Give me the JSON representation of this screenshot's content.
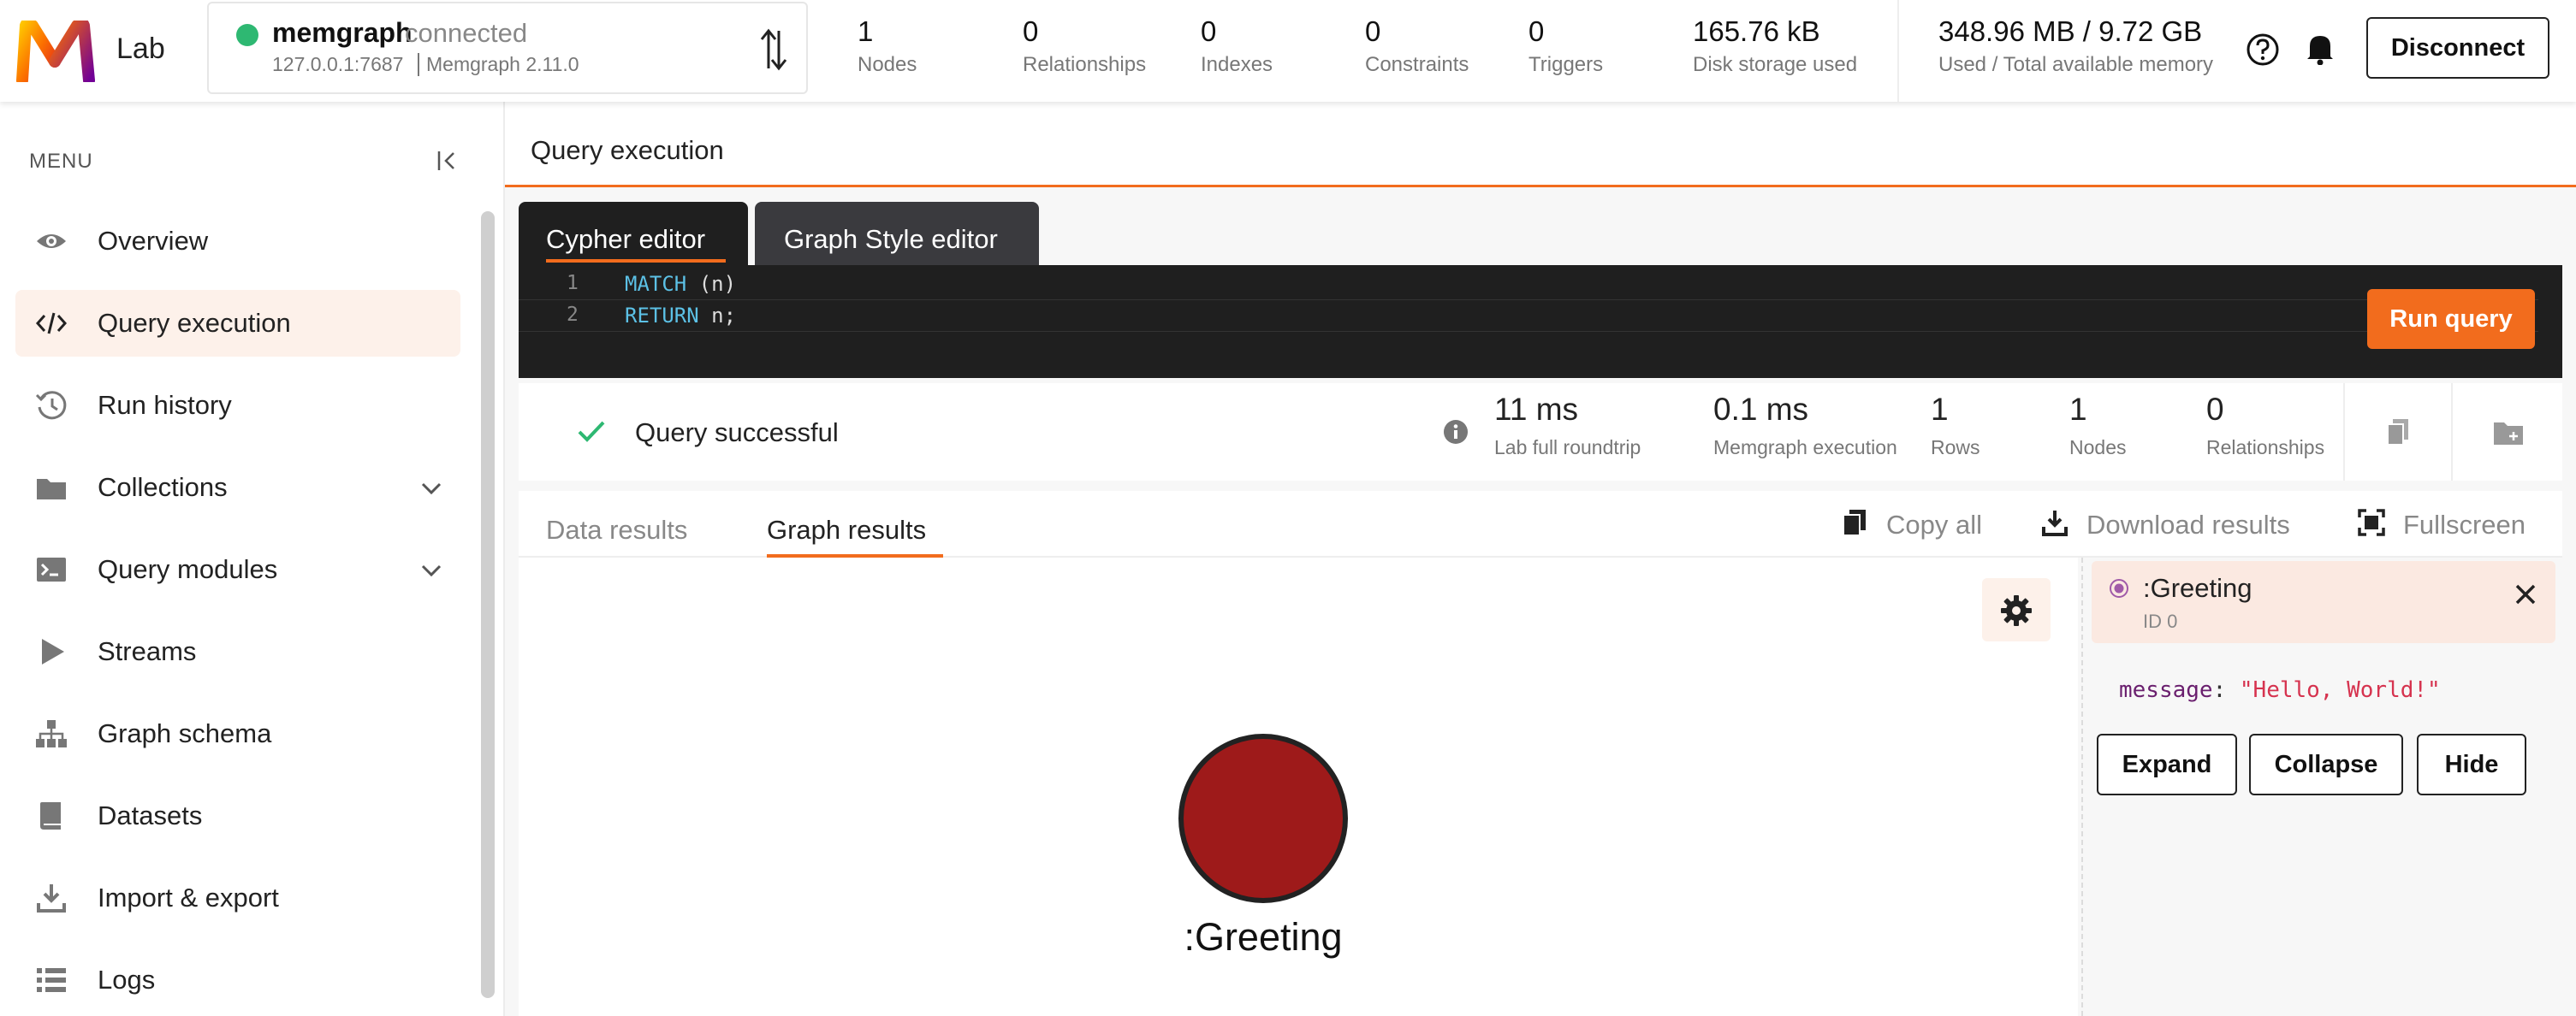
{
  "app": {
    "name": "Lab"
  },
  "connection": {
    "name": "memgraph",
    "status": "connected",
    "host": "127.0.0.1:7687",
    "version": "Memgraph 2.11.0"
  },
  "stats": [
    {
      "value": "1",
      "label": "Nodes"
    },
    {
      "value": "0",
      "label": "Relationships"
    },
    {
      "value": "0",
      "label": "Indexes"
    },
    {
      "value": "0",
      "label": "Constraints"
    },
    {
      "value": "0",
      "label": "Triggers"
    },
    {
      "value": "165.76 kB",
      "label": "Disk storage used"
    }
  ],
  "memory": {
    "value": "348.96 MB / 9.72 GB",
    "label": "Used / Total available memory"
  },
  "header": {
    "disconnect_label": "Disconnect"
  },
  "sidebar": {
    "title": "MENU",
    "items": [
      {
        "label": "Overview",
        "icon": "eye-icon"
      },
      {
        "label": "Query execution",
        "icon": "code-icon",
        "active": true
      },
      {
        "label": "Run history",
        "icon": "history-icon"
      },
      {
        "label": "Collections",
        "icon": "folder-icon"
      },
      {
        "label": "Query modules",
        "icon": "terminal-icon"
      },
      {
        "label": "Streams",
        "icon": "play-icon"
      },
      {
        "label": "Graph schema",
        "icon": "schema-icon"
      },
      {
        "label": "Datasets",
        "icon": "book-icon"
      },
      {
        "label": "Import & export",
        "icon": "download-icon"
      },
      {
        "label": "Logs",
        "icon": "list-icon"
      }
    ]
  },
  "page": {
    "title": "Query execution"
  },
  "editor": {
    "tabs": [
      {
        "label": "Cypher editor"
      },
      {
        "label": "Graph Style editor"
      }
    ],
    "lines": [
      {
        "num": "1",
        "keyword": "MATCH",
        "rest": " (n)"
      },
      {
        "num": "2",
        "keyword": "RETURN",
        "rest": " n;"
      }
    ],
    "run_label": "Run query"
  },
  "status": {
    "text": "Query successful",
    "metrics": [
      {
        "value": "11 ms",
        "label": "Lab full roundtrip"
      },
      {
        "value": "0.1 ms",
        "label": "Memgraph execution"
      },
      {
        "value": "1",
        "label": "Rows"
      },
      {
        "value": "1",
        "label": "Nodes"
      },
      {
        "value": "0",
        "label": "Relationships"
      }
    ]
  },
  "results": {
    "tabs": [
      {
        "label": "Data results"
      },
      {
        "label": "Graph results",
        "active": true
      }
    ],
    "actions": [
      {
        "label": "Copy all"
      },
      {
        "label": "Download results"
      },
      {
        "label": "Fullscreen"
      }
    ]
  },
  "graph": {
    "node_label": ":Greeting",
    "node_color": "#9e1a1a"
  },
  "panel": {
    "title": ":Greeting",
    "id": "ID 0",
    "property_key": "message",
    "property_value": "\"Hello, World!\"",
    "buttons": {
      "expand": "Expand",
      "collapse": "Collapse",
      "hide": "Hide"
    }
  },
  "colors": {
    "accent": "#f26c1d",
    "success": "#2eb872",
    "node": "#9e1a1a"
  }
}
